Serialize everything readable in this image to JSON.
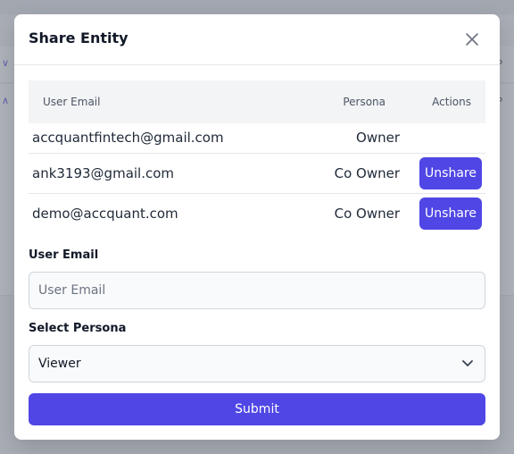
{
  "modal": {
    "title": "Share Entity",
    "close_icon": "close-icon"
  },
  "table": {
    "headers": {
      "email": "User Email",
      "persona": "Persona",
      "actions": "Actions"
    },
    "rows": [
      {
        "email": "accquantfintech@gmail.com",
        "persona": "Owner",
        "action": ""
      },
      {
        "email": "ank3193@gmail.com",
        "persona": "Co Owner",
        "action": "Unshare"
      },
      {
        "email": "demo@accquant.com",
        "persona": "Co Owner",
        "action": "Unshare"
      }
    ]
  },
  "form": {
    "email_label": "User Email",
    "email_placeholder": "User Email",
    "email_value": "",
    "persona_label": "Select Persona",
    "persona_value": "Viewer",
    "submit_label": "Submit"
  },
  "colors": {
    "accent": "#4f46e5",
    "overlay": "#6b7280",
    "header_bg": "#f3f4f6"
  }
}
